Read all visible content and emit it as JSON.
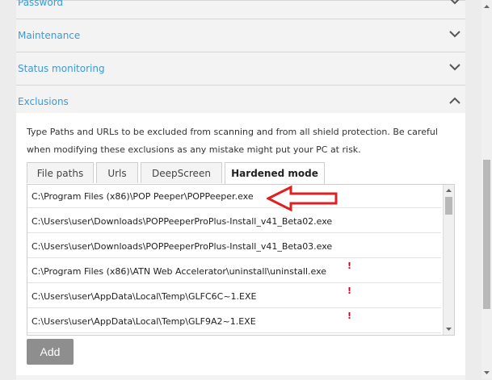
{
  "sections": {
    "password": "Password",
    "maintenance": "Maintenance",
    "status_monitoring": "Status monitoring",
    "exclusions": "Exclusions"
  },
  "exclusions": {
    "description": "Type Paths and URLs to be excluded from scanning and from all shield protection. Be careful when modifying these exclusions as any mistake might put your PC at risk.",
    "tabs": [
      "File paths",
      "Urls",
      "DeepScreen",
      "Hardened mode"
    ],
    "active_tab": "Hardened mode",
    "rows": [
      {
        "path": "C:\\Program Files (x86)\\POP Peeper\\POPPeeper.exe",
        "warning": ""
      },
      {
        "path": "C:\\Users\\user\\Downloads\\POPPeeperProPlus-Install_v41_Beta02.exe",
        "warning": ""
      },
      {
        "path": "C:\\Users\\user\\Downloads\\POPPeeperProPlus-Install_v41_Beta03.exe",
        "warning": ""
      },
      {
        "path": "C:\\Program Files (x86)\\ATN Web Accelerator\\uninstall\\uninstall.exe",
        "warning": "!"
      },
      {
        "path": "C:\\Users\\user\\AppData\\Local\\Temp\\GLFC6C~1.EXE",
        "warning": "!"
      },
      {
        "path": "C:\\Users\\user\\AppData\\Local\\Temp\\GLF9A2~1.EXE",
        "warning": "!"
      }
    ],
    "add_label": "Add"
  },
  "colors": {
    "accent": "#3a9ad9",
    "annotation_arrow": "#e02020",
    "warning": "#d4001c"
  },
  "icons": {
    "collapsed": "chevron-down-icon",
    "expanded": "chevron-up-icon"
  }
}
